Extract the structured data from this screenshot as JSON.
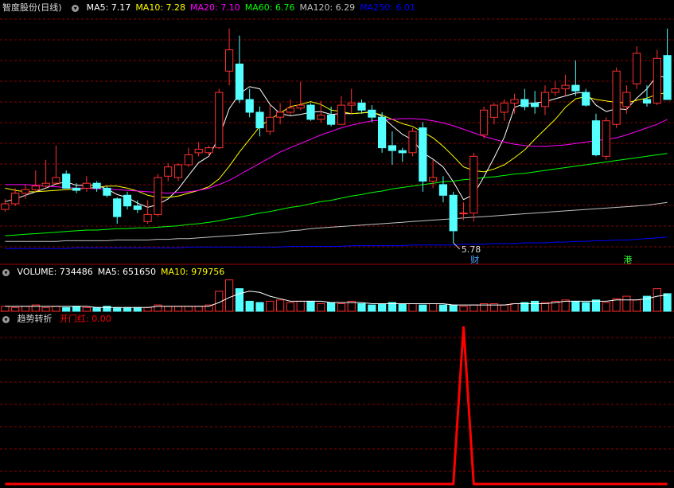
{
  "stock_title": "智度股份(日线)",
  "main_indicators": [
    {
      "label": "MA5:",
      "value": "7.17",
      "color": "#ffffff"
    },
    {
      "label": "MA10:",
      "value": "7.28",
      "color": "#ffff00"
    },
    {
      "label": "MA20:",
      "value": "7.10",
      "color": "#ff00ff"
    },
    {
      "label": "MA60:",
      "value": "6.76",
      "color": "#00ff00"
    },
    {
      "label": "MA120:",
      "value": "6.29",
      "color": "#c0c0c0"
    },
    {
      "label": "MA250:",
      "value": "6.01",
      "color": "#0000ff"
    }
  ],
  "volume_indicators": [
    {
      "label": "VOLUME:",
      "value": "734486",
      "color": "#ffffff"
    },
    {
      "label": "MA5:",
      "value": "651650",
      "color": "#ffffff"
    },
    {
      "label": "MA10:",
      "value": "979756",
      "color": "#ffff00"
    }
  ],
  "bottom_title": "趋势转折",
  "bottom_indicator": {
    "label": "开门红:",
    "value": "0.00",
    "color": "#ff0000"
  },
  "low_marker": "5.78",
  "event_tags": [
    {
      "text": "财",
      "color": "#4aa3ff"
    },
    {
      "text": "港",
      "color": "#33ff33"
    }
  ],
  "colors": {
    "up": "#ff3030",
    "down": "#54ffff",
    "grid": "#8b0000",
    "signal": "#ff0000"
  },
  "chart_data": {
    "type": "candlestick",
    "candles": [
      [
        6.25,
        6.4,
        6.22,
        6.33
      ],
      [
        6.33,
        6.55,
        6.3,
        6.48
      ],
      [
        6.48,
        6.6,
        6.4,
        6.53
      ],
      [
        6.53,
        6.8,
        6.5,
        6.58
      ],
      [
        6.58,
        6.95,
        6.55,
        6.62
      ],
      [
        6.62,
        7.15,
        6.6,
        6.7
      ],
      [
        6.75,
        6.8,
        6.68,
        6.55
      ],
      [
        6.55,
        6.62,
        6.48,
        6.52
      ],
      [
        6.55,
        6.72,
        6.5,
        6.62
      ],
      [
        6.62,
        6.65,
        6.5,
        6.55
      ],
      [
        6.55,
        6.58,
        6.42,
        6.45
      ],
      [
        6.4,
        6.42,
        6.05,
        6.15
      ],
      [
        6.45,
        6.5,
        6.25,
        6.3
      ],
      [
        6.3,
        6.38,
        6.2,
        6.25
      ],
      [
        6.08,
        6.38,
        6.05,
        6.18
      ],
      [
        6.18,
        6.75,
        6.15,
        6.7
      ],
      [
        6.72,
        6.9,
        6.65,
        6.85
      ],
      [
        6.7,
        6.9,
        6.65,
        6.88
      ],
      [
        6.88,
        7.12,
        6.85,
        7.02
      ],
      [
        7.05,
        7.2,
        7.0,
        7.1
      ],
      [
        7.05,
        7.15,
        7.0,
        7.12
      ],
      [
        7.12,
        7.95,
        7.1,
        7.9
      ],
      [
        8.2,
        8.8,
        8.0,
        8.5
      ],
      [
        8.3,
        8.7,
        7.75,
        7.8
      ],
      [
        7.8,
        7.95,
        7.55,
        7.62
      ],
      [
        7.62,
        7.7,
        7.28,
        7.4
      ],
      [
        7.35,
        7.72,
        7.3,
        7.55
      ],
      [
        7.55,
        7.75,
        7.45,
        7.62
      ],
      [
        7.62,
        7.8,
        7.58,
        7.68
      ],
      [
        7.68,
        8.05,
        7.65,
        7.72
      ],
      [
        7.72,
        7.75,
        7.5,
        7.52
      ],
      [
        7.52,
        7.78,
        7.48,
        7.58
      ],
      [
        7.58,
        7.7,
        7.42,
        7.45
      ],
      [
        7.45,
        7.85,
        7.45,
        7.72
      ],
      [
        7.72,
        7.95,
        7.6,
        7.75
      ],
      [
        7.75,
        7.8,
        7.6,
        7.65
      ],
      [
        7.65,
        7.72,
        7.48,
        7.55
      ],
      [
        7.55,
        7.62,
        7.05,
        7.12
      ],
      [
        7.15,
        7.35,
        6.88,
        7.08
      ],
      [
        7.08,
        7.12,
        6.92,
        7.05
      ],
      [
        7.05,
        7.4,
        7.0,
        7.35
      ],
      [
        7.4,
        7.48,
        6.5,
        6.65
      ],
      [
        6.65,
        6.95,
        6.55,
        6.7
      ],
      [
        6.6,
        6.72,
        6.35,
        6.45
      ],
      [
        6.45,
        6.5,
        5.78,
        5.95
      ],
      [
        6.2,
        6.35,
        6.1,
        6.2
      ],
      [
        6.2,
        7.05,
        6.08,
        7.0
      ],
      [
        7.3,
        7.7,
        7.25,
        7.65
      ],
      [
        7.55,
        7.75,
        7.45,
        7.72
      ],
      [
        7.62,
        7.8,
        7.5,
        7.75
      ],
      [
        7.75,
        7.88,
        7.6,
        7.8
      ],
      [
        7.8,
        7.95,
        7.65,
        7.7
      ],
      [
        7.75,
        7.92,
        7.6,
        7.7
      ],
      [
        7.7,
        8.0,
        7.58,
        7.9
      ],
      [
        7.9,
        8.05,
        7.85,
        7.95
      ],
      [
        7.95,
        8.15,
        7.85,
        8.0
      ],
      [
        8.0,
        8.35,
        7.85,
        7.92
      ],
      [
        7.9,
        7.95,
        7.7,
        7.72
      ],
      [
        7.5,
        7.6,
        7.0,
        7.02
      ],
      [
        7.0,
        7.55,
        6.95,
        7.5
      ],
      [
        7.45,
        8.25,
        7.4,
        8.2
      ],
      [
        7.7,
        8.0,
        7.6,
        7.9
      ],
      [
        8.02,
        8.55,
        7.95,
        8.45
      ],
      [
        7.8,
        8.0,
        7.7,
        7.75
      ],
      [
        7.75,
        8.5,
        7.72,
        8.38
      ],
      [
        8.42,
        8.8,
        7.9,
        7.8
      ]
    ],
    "ma_lines": [
      {
        "name": "MA5",
        "color": "#ffffff",
        "values": [
          6.36,
          6.4,
          6.45,
          6.5,
          6.55,
          6.61,
          6.64,
          6.59,
          6.59,
          6.59,
          6.54,
          6.46,
          6.42,
          6.34,
          6.28,
          6.32,
          6.4,
          6.54,
          6.73,
          6.91,
          7.0,
          7.27,
          7.67,
          7.88,
          7.98,
          7.95,
          7.73,
          7.6,
          7.57,
          7.59,
          7.62,
          7.63,
          7.59,
          7.6,
          7.6,
          7.61,
          7.63,
          7.56,
          7.43,
          7.31,
          7.23,
          7.05,
          6.96,
          6.85,
          6.64,
          6.39,
          6.46,
          6.71,
          6.98,
          7.27,
          7.69,
          7.74,
          7.75,
          7.77,
          7.81,
          7.85,
          7.89,
          7.9,
          7.72,
          7.63,
          7.67,
          7.66,
          7.82,
          7.95,
          8.14,
          8.1
        ]
      },
      {
        "name": "MA10",
        "color": "#ffff00",
        "values": [
          6.55,
          6.52,
          6.5,
          6.5,
          6.51,
          6.52,
          6.53,
          6.54,
          6.55,
          6.56,
          6.58,
          6.58,
          6.55,
          6.51,
          6.45,
          6.42,
          6.42,
          6.44,
          6.48,
          6.52,
          6.57,
          6.68,
          6.86,
          7.06,
          7.24,
          7.42,
          7.52,
          7.61,
          7.7,
          7.73,
          7.77,
          7.73,
          7.65,
          7.63,
          7.6,
          7.61,
          7.62,
          7.58,
          7.52,
          7.46,
          7.42,
          7.34,
          7.26,
          7.14,
          7.0,
          6.85,
          6.8,
          6.78,
          6.82,
          6.88,
          6.98,
          7.09,
          7.24,
          7.38,
          7.52,
          7.69,
          7.81,
          7.84,
          7.8,
          7.78,
          7.76,
          7.75,
          7.79,
          7.82,
          7.87,
          7.9
        ]
      },
      {
        "name": "MA20",
        "color": "#ff00ff",
        "values": [
          6.6,
          6.6,
          6.6,
          6.59,
          6.58,
          6.57,
          6.56,
          6.55,
          6.55,
          6.54,
          6.54,
          6.53,
          6.52,
          6.51,
          6.5,
          6.49,
          6.48,
          6.49,
          6.5,
          6.52,
          6.55,
          6.6,
          6.66,
          6.74,
          6.82,
          6.9,
          6.98,
          7.06,
          7.12,
          7.18,
          7.24,
          7.3,
          7.35,
          7.4,
          7.44,
          7.47,
          7.5,
          7.51,
          7.52,
          7.53,
          7.53,
          7.52,
          7.5,
          7.47,
          7.43,
          7.38,
          7.33,
          7.28,
          7.24,
          7.2,
          7.17,
          7.15,
          7.14,
          7.14,
          7.15,
          7.16,
          7.18,
          7.2,
          7.22,
          7.24,
          7.26,
          7.3,
          7.35,
          7.4,
          7.45,
          7.52
        ]
      },
      {
        "name": "MA60",
        "color": "#00ff00",
        "values": [
          5.88,
          5.89,
          5.9,
          5.91,
          5.92,
          5.93,
          5.94,
          5.95,
          5.96,
          5.96,
          5.97,
          5.98,
          5.98,
          5.99,
          5.99,
          6.0,
          6.01,
          6.02,
          6.04,
          6.05,
          6.07,
          6.09,
          6.12,
          6.14,
          6.17,
          6.2,
          6.22,
          6.25,
          6.28,
          6.3,
          6.33,
          6.36,
          6.38,
          6.41,
          6.44,
          6.46,
          6.49,
          6.51,
          6.54,
          6.56,
          6.58,
          6.6,
          6.62,
          6.64,
          6.65,
          6.67,
          6.68,
          6.7,
          6.71,
          6.73,
          6.75,
          6.76,
          6.78,
          6.8,
          6.82,
          6.84,
          6.86,
          6.88,
          6.9,
          6.92,
          6.94,
          6.96,
          6.98,
          7.0,
          7.02,
          7.04
        ]
      },
      {
        "name": "MA120",
        "color": "#c0c0c0",
        "values": [
          5.8,
          5.8,
          5.8,
          5.8,
          5.8,
          5.8,
          5.81,
          5.81,
          5.81,
          5.81,
          5.81,
          5.82,
          5.82,
          5.82,
          5.82,
          5.83,
          5.83,
          5.84,
          5.84,
          5.85,
          5.86,
          5.87,
          5.88,
          5.89,
          5.9,
          5.91,
          5.92,
          5.93,
          5.95,
          5.96,
          5.98,
          5.99,
          6.0,
          6.01,
          6.02,
          6.03,
          6.04,
          6.05,
          6.06,
          6.07,
          6.08,
          6.09,
          6.1,
          6.11,
          6.12,
          6.13,
          6.14,
          6.15,
          6.16,
          6.17,
          6.18,
          6.19,
          6.2,
          6.21,
          6.22,
          6.23,
          6.24,
          6.25,
          6.26,
          6.27,
          6.28,
          6.29,
          6.3,
          6.31,
          6.33,
          6.35
        ]
      },
      {
        "name": "MA250",
        "color": "#0000ff",
        "values": [
          5.7,
          5.7,
          5.7,
          5.7,
          5.7,
          5.7,
          5.7,
          5.71,
          5.71,
          5.71,
          5.71,
          5.71,
          5.71,
          5.71,
          5.71,
          5.71,
          5.71,
          5.71,
          5.72,
          5.72,
          5.72,
          5.72,
          5.72,
          5.72,
          5.72,
          5.72,
          5.72,
          5.72,
          5.73,
          5.73,
          5.73,
          5.73,
          5.73,
          5.73,
          5.74,
          5.74,
          5.74,
          5.74,
          5.74,
          5.74,
          5.75,
          5.75,
          5.75,
          5.75,
          5.75,
          5.76,
          5.76,
          5.76,
          5.77,
          5.77,
          5.77,
          5.78,
          5.78,
          5.78,
          5.79,
          5.79,
          5.8,
          5.8,
          5.81,
          5.81,
          5.82,
          5.82,
          5.83,
          5.84,
          5.85,
          5.86
        ]
      }
    ],
    "volume": [
      4,
      3,
      4,
      5,
      3,
      4,
      3,
      4,
      3,
      3,
      4,
      3,
      3,
      3,
      3,
      5,
      4,
      4,
      4,
      4,
      5,
      16,
      25,
      18,
      8,
      7,
      8,
      9,
      7,
      8,
      8,
      6,
      7,
      6,
      8,
      6,
      5,
      6,
      7,
      6,
      6,
      5,
      6,
      5,
      5,
      4,
      5,
      6,
      6,
      5,
      6,
      7,
      8,
      7,
      8,
      9,
      8,
      7,
      9,
      7,
      10,
      12,
      9,
      12,
      18,
      14
    ],
    "volume_ma5": [
      4,
      4,
      4,
      4,
      4,
      4,
      4,
      4,
      4,
      3,
      3,
      3,
      3,
      3,
      3,
      4,
      4,
      4,
      4,
      4,
      4,
      7,
      11,
      14,
      16,
      15,
      12,
      10,
      8,
      8,
      8,
      8,
      7,
      7,
      7,
      7,
      6,
      6,
      6,
      6,
      6,
      6,
      6,
      6,
      5,
      5,
      5,
      5,
      5,
      5,
      6,
      6,
      6,
      6,
      7,
      8,
      8,
      8,
      8,
      8,
      9,
      9,
      9,
      10,
      12,
      13
    ],
    "signal": [
      0,
      0,
      0,
      0,
      0,
      0,
      0,
      0,
      0,
      0,
      0,
      0,
      0,
      0,
      0,
      0,
      0,
      0,
      0,
      0,
      0,
      0,
      0,
      0,
      0,
      0,
      0,
      0,
      0,
      0,
      0,
      0,
      0,
      0,
      0,
      0,
      0,
      0,
      0,
      0,
      0,
      0,
      0,
      0,
      0,
      0,
      0,
      0,
      0,
      0,
      0,
      0,
      0,
      0,
      0,
      0,
      0,
      0,
      0,
      0,
      0,
      0,
      0,
      0,
      0,
      0
    ],
    "signal_peak_index": 45,
    "ylim": [
      5.5,
      9.0
    ],
    "volume_ylim": [
      0,
      26
    ],
    "signal_ylim": [
      0,
      1
    ],
    "low_index": 44,
    "tag_indices": [
      46,
      61
    ]
  }
}
